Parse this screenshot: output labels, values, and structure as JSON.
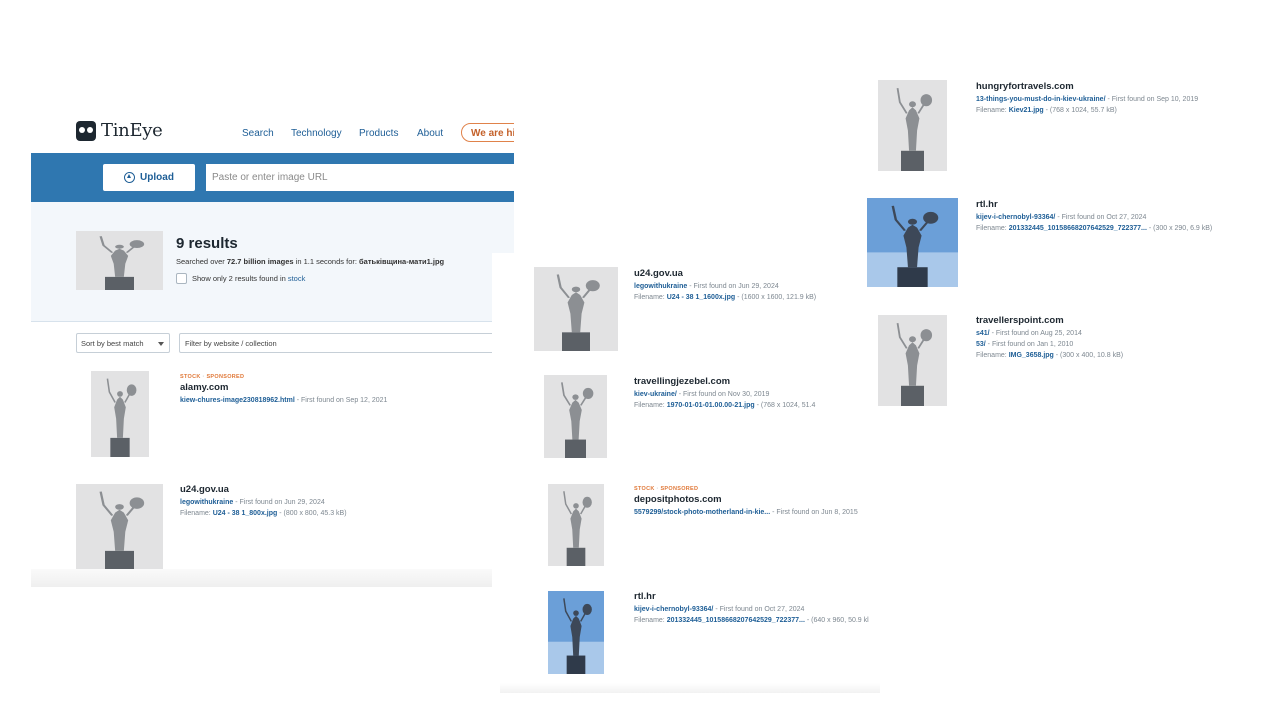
{
  "header": {
    "logo_text": "TinEye",
    "nav": [
      "Search",
      "Technology",
      "Products",
      "About"
    ],
    "hire_label": "We are hi"
  },
  "search": {
    "upload_label": "Upload",
    "url_placeholder": "Paste or enter image URL"
  },
  "summary": {
    "results_count": "9 results",
    "searched_prefix": "Searched over ",
    "searched_count": "72.7 billion images",
    "searched_mid": " in 1.1 seconds for: ",
    "query_filename": "батьківщина-мати1.jpg",
    "stock_text": "Show only 2 results found in ",
    "stock_link": "stock"
  },
  "controls": {
    "sort_label": "Sort by best match",
    "filter_placeholder": "Filter by website / collection"
  },
  "results": [
    {
      "tag": "STOCK",
      "tag2": "SPONSORED",
      "site": "alamy.com",
      "lines": [
        {
          "link": "kiew-chures-image230818962.html",
          "text": " - First found on Sep 12, 2021"
        }
      ]
    },
    {
      "site": "u24.gov.ua",
      "lines": [
        {
          "link": "legowithukraine",
          "text": " - First found on Jun 29, 2024"
        },
        {
          "label": "Filename: ",
          "link": "U24 - 38 1_800x.jpg",
          "text": " - (800 x 800, 45.3 kB)"
        }
      ]
    },
    {
      "site": "u24.gov.ua",
      "lines": [
        {
          "link": "legowithukraine",
          "text": " - First found on Jun 29, 2024"
        },
        {
          "label": "Filename: ",
          "link": "U24 - 38 1_1600x.jpg",
          "text": " - (1600 x 1600, 121.9 kB)"
        }
      ]
    },
    {
      "site": "travellingjezebel.com",
      "lines": [
        {
          "link": "kiev-ukraine/",
          "text": " - First found on Nov 30, 2019"
        },
        {
          "label": "Filename: ",
          "link": "1970-01-01-01.00.00-21.jpg",
          "text": " - (768 x 1024, 51.4"
        }
      ]
    },
    {
      "tag": "STOCK",
      "tag2": "SPONSORED",
      "site": "depositphotos.com",
      "lines": [
        {
          "link": "5579299/stock-photo-motherland-in-kie...",
          "text": " - First found on Jun 8, 2015"
        }
      ]
    },
    {
      "site": "rtl.hr",
      "lines": [
        {
          "link": "kijev-i-chernobyl-93364/",
          "text": " - First found on Oct 27, 2024"
        },
        {
          "label": "Filename: ",
          "link": "201332445_10158668207642529_722377...",
          "text": " - (640 x 960, 50.9 kl"
        }
      ]
    },
    {
      "site": "hungryfortravels.com",
      "lines": [
        {
          "link": "13-things-you-must-do-in-kiev-ukraine/",
          "text": " - First found on Sep 10, 2019"
        },
        {
          "label": "Filename: ",
          "link": "Kiev21.jpg",
          "text": " - (768 x 1024, 55.7 kB)"
        }
      ]
    },
    {
      "site": "rtl.hr",
      "lines": [
        {
          "link": "kijev-i-chernobyl-93364/",
          "text": " - First found on Oct 27, 2024"
        },
        {
          "label": "Filename: ",
          "link": "201332445_10158668207642529_722377...",
          "text": " - (300 x 290, 6.9 kB)"
        }
      ]
    },
    {
      "site": "travellerspoint.com",
      "lines": [
        {
          "link": "s41/",
          "text": " - First found on Aug 25, 2014"
        },
        {
          "link": "53/",
          "text": " - First found on Jan 1, 2010"
        },
        {
          "label": "Filename: ",
          "link": "IMG_3658.jpg",
          "text": " - (300 x 400, 10.8 kB)"
        }
      ]
    }
  ],
  "colors": {
    "accent": "#2f77b0",
    "link": "#1e5e96",
    "stock_tag": "#e07838",
    "summary_bg": "#f3f7fb"
  },
  "icons": {
    "logo": "tineye-logo-icon",
    "upload": "upload-icon",
    "sort": "chevron-down-icon"
  }
}
